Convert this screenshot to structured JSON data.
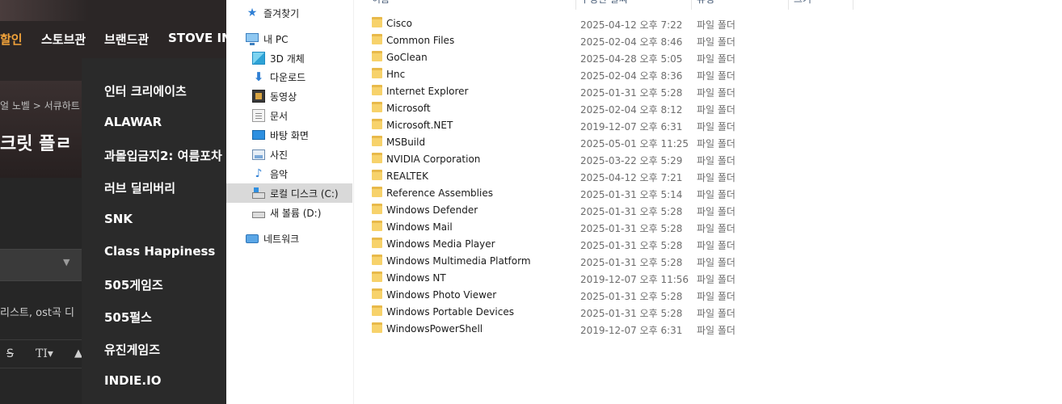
{
  "web": {
    "nav": {
      "sale": "할인",
      "store": "스토브관",
      "brand": "브랜드관",
      "stove": "STOVE IN"
    },
    "breadcrumb": "얼 노벨 > 서큐하트",
    "title": "크릿 플ㄹ",
    "tagline": "리스트, ost곡 디",
    "editor": {
      "strike": "S",
      "size": "TI▾",
      "color": "▲"
    },
    "dropdown": [
      "인터 크리에이츠",
      "ALAWAR",
      "과몰입금지2: 여름포차",
      "러브 딜리버리",
      "SNK",
      "Class Happiness",
      "505게임즈",
      "505펄스",
      "유진게임즈",
      "INDIE.IO"
    ]
  },
  "explorer": {
    "nav_pane": [
      {
        "label": "즐겨찾기",
        "icon": "star-icon"
      },
      {
        "label": "내 PC",
        "icon": "pc-icon"
      },
      {
        "label": "3D 개체",
        "icon": "3d-objects-icon"
      },
      {
        "label": "다운로드",
        "icon": "download-icon"
      },
      {
        "label": "동영상",
        "icon": "video-icon"
      },
      {
        "label": "문서",
        "icon": "document-icon"
      },
      {
        "label": "바탕 화면",
        "icon": "desktop-icon"
      },
      {
        "label": "사진",
        "icon": "pictures-icon"
      },
      {
        "label": "음악",
        "icon": "music-icon"
      },
      {
        "label": "로컬 디스크 (C:)",
        "icon": "local-disk-icon"
      },
      {
        "label": "새 볼륨 (D:)",
        "icon": "drive-icon"
      },
      {
        "label": "네트워크",
        "icon": "network-icon"
      }
    ],
    "columns": {
      "name": "이름",
      "date": "수정한 날짜",
      "type": "유형",
      "size": "크기"
    },
    "files": [
      {
        "name": "Cisco",
        "date": "2025-04-12 오후 7:22",
        "type": "파일 폴더"
      },
      {
        "name": "Common Files",
        "date": "2025-02-04 오후 8:46",
        "type": "파일 폴더"
      },
      {
        "name": "GoClean",
        "date": "2025-04-28 오후 5:05",
        "type": "파일 폴더"
      },
      {
        "name": "Hnc",
        "date": "2025-02-04 오후 8:36",
        "type": "파일 폴더"
      },
      {
        "name": "Internet Explorer",
        "date": "2025-01-31 오후 5:28",
        "type": "파일 폴더"
      },
      {
        "name": "Microsoft",
        "date": "2025-02-04 오후 8:12",
        "type": "파일 폴더"
      },
      {
        "name": "Microsoft.NET",
        "date": "2019-12-07 오후 6:31",
        "type": "파일 폴더"
      },
      {
        "name": "MSBuild",
        "date": "2025-05-01 오후 11:25",
        "type": "파일 폴더"
      },
      {
        "name": "NVIDIA Corporation",
        "date": "2025-03-22 오후 5:29",
        "type": "파일 폴더"
      },
      {
        "name": "REALTEK",
        "date": "2025-04-12 오후 7:21",
        "type": "파일 폴더"
      },
      {
        "name": "Reference Assemblies",
        "date": "2025-01-31 오후 5:14",
        "type": "파일 폴더"
      },
      {
        "name": "Windows Defender",
        "date": "2025-01-31 오후 5:28",
        "type": "파일 폴더"
      },
      {
        "name": "Windows Mail",
        "date": "2025-01-31 오후 5:28",
        "type": "파일 폴더"
      },
      {
        "name": "Windows Media Player",
        "date": "2025-01-31 오후 5:28",
        "type": "파일 폴더"
      },
      {
        "name": "Windows Multimedia Platform",
        "date": "2025-01-31 오후 5:28",
        "type": "파일 폴더"
      },
      {
        "name": "Windows NT",
        "date": "2019-12-07 오후 11:56",
        "type": "파일 폴더"
      },
      {
        "name": "Windows Photo Viewer",
        "date": "2025-01-31 오후 5:28",
        "type": "파일 폴더"
      },
      {
        "name": "Windows Portable Devices",
        "date": "2025-01-31 오후 5:28",
        "type": "파일 폴더"
      },
      {
        "name": "WindowsPowerShell",
        "date": "2019-12-07 오후 6:31",
        "type": "파일 폴더"
      }
    ]
  }
}
